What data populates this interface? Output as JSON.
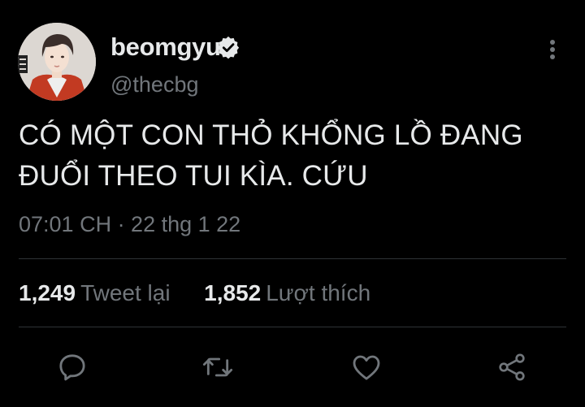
{
  "user": {
    "display_name": "beomgyu",
    "handle": "@thecbg",
    "verified": true,
    "avatar": "profile-photo"
  },
  "tweet": {
    "text_line1": "CÓ MỘT CON THỎ KHỔNG LỒ ĐANG",
    "text_line2": "ĐUỔI THEO TUI KÌA. CỨU",
    "timestamp": "07:01 CH · 22 thg 1 22"
  },
  "stats": {
    "retweets_count": "1,249",
    "retweets_label": "Tweet lại",
    "likes_count": "1,852",
    "likes_label": "Lượt thích"
  },
  "actions": {
    "reply_icon": "reply-icon",
    "retweet_icon": "retweet-icon",
    "like_icon": "heart-icon",
    "share_icon": "share-icon"
  },
  "colors": {
    "background": "#000000",
    "primary_text": "#e7e9ea",
    "secondary_text": "#71767b",
    "divider": "#2f3336"
  }
}
